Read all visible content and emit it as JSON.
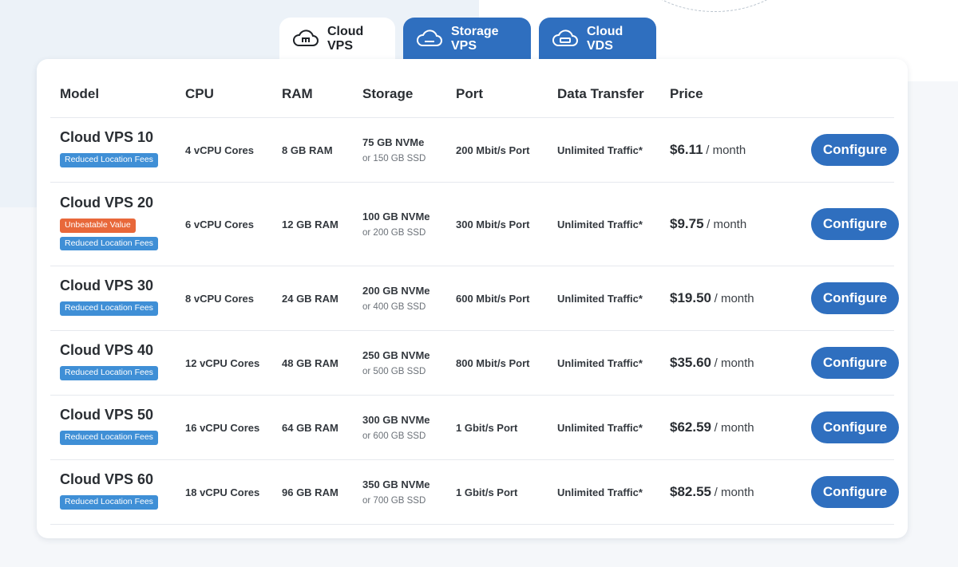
{
  "tabs": [
    {
      "label": "Cloud VPS",
      "active": true,
      "icon": "cloud-icon"
    },
    {
      "label": "Storage VPS",
      "active": false,
      "icon": "cloud-storage-icon"
    },
    {
      "label": "Cloud VDS",
      "active": false,
      "icon": "cloud-server-icon"
    }
  ],
  "table": {
    "headers": [
      "Model",
      "CPU",
      "RAM",
      "Storage",
      "Port",
      "Data Transfer",
      "Price"
    ],
    "rows": [
      {
        "model": "Cloud VPS 10",
        "badges": [
          "Reduced Location Fees"
        ],
        "cpu": "4 vCPU Cores",
        "ram": "8 GB RAM",
        "storage": "75 GB NVMe",
        "storage_alt": "or 150 GB SSD",
        "port": "200 Mbit/s Port",
        "transfer": "Unlimited Traffic*",
        "price": "$6.11",
        "price_unit": "/ month",
        "button": "Configure"
      },
      {
        "model": "Cloud VPS 20",
        "badges": [
          "Unbeatable Value",
          "Reduced Location Fees"
        ],
        "cpu": "6 vCPU Cores",
        "ram": "12 GB RAM",
        "storage": "100 GB NVMe",
        "storage_alt": "or 200 GB SSD",
        "port": "300 Mbit/s Port",
        "transfer": "Unlimited Traffic*",
        "price": "$9.75",
        "price_unit": "/ month",
        "button": "Configure"
      },
      {
        "model": "Cloud VPS 30",
        "badges": [
          "Reduced Location Fees"
        ],
        "cpu": "8 vCPU Cores",
        "ram": "24 GB RAM",
        "storage": "200 GB NVMe",
        "storage_alt": "or 400 GB SSD",
        "port": "600 Mbit/s Port",
        "transfer": "Unlimited Traffic*",
        "price": "$19.50",
        "price_unit": "/ month",
        "button": "Configure"
      },
      {
        "model": "Cloud VPS 40",
        "badges": [
          "Reduced Location Fees"
        ],
        "cpu": "12 vCPU Cores",
        "ram": "48 GB RAM",
        "storage": "250 GB NVMe",
        "storage_alt": "or 500 GB SSD",
        "port": "800 Mbit/s Port",
        "transfer": "Unlimited Traffic*",
        "price": "$35.60",
        "price_unit": "/ month",
        "button": "Configure"
      },
      {
        "model": "Cloud VPS 50",
        "badges": [
          "Reduced Location Fees"
        ],
        "cpu": "16 vCPU Cores",
        "ram": "64 GB RAM",
        "storage": "300 GB NVMe",
        "storage_alt": "or 600 GB SSD",
        "port": "1 Gbit/s Port",
        "transfer": "Unlimited Traffic*",
        "price": "$62.59",
        "price_unit": "/ month",
        "button": "Configure"
      },
      {
        "model": "Cloud VPS 60",
        "badges": [
          "Reduced Location Fees"
        ],
        "cpu": "18 vCPU Cores",
        "ram": "96 GB RAM",
        "storage": "350 GB NVMe",
        "storage_alt": "or 700 GB SSD",
        "port": "1 Gbit/s Port",
        "transfer": "Unlimited Traffic*",
        "price": "$82.55",
        "price_unit": "/ month",
        "button": "Configure"
      }
    ]
  },
  "colors": {
    "accent": "#2f6fbf",
    "badge_blue": "#3f8fd6",
    "badge_orange": "#e8683a"
  }
}
